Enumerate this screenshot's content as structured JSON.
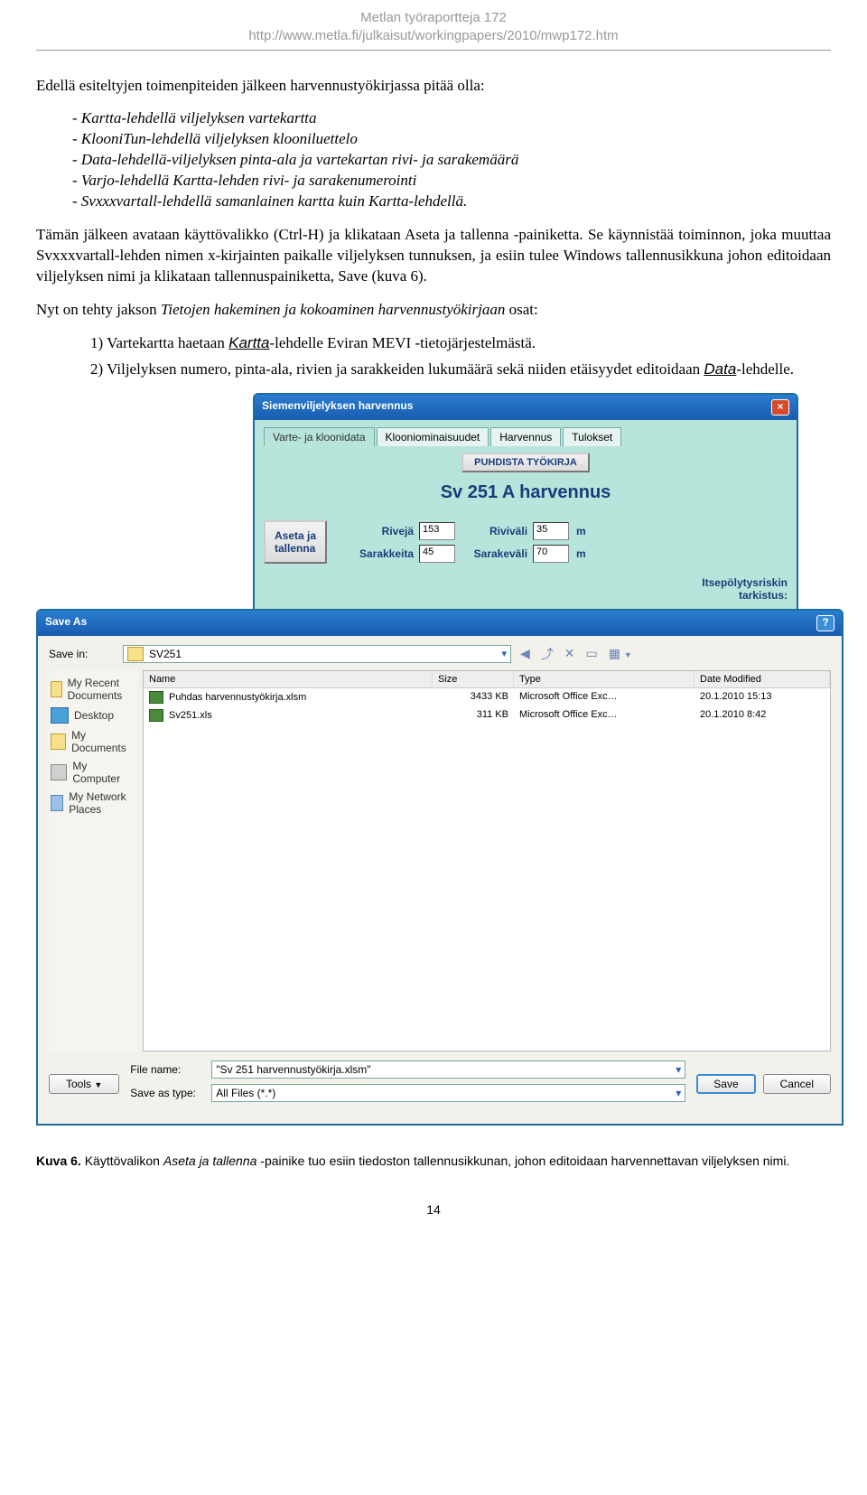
{
  "header": {
    "line1": "Metlan työraportteja 172",
    "line2": "http://www.metla.fi/julkaisut/workingpapers/2010/mwp172.htm"
  },
  "para1_lead": "Edellä esiteltyjen toimenpiteiden jälkeen harvennustyökirjassa pitää olla:",
  "bullets": [
    "Kartta-lehdellä viljelyksen vartekartta",
    "KlooniTun-lehdellä viljelyksen klooniluettelo",
    "Data-lehdellä-viljelyksen pinta-ala ja vartekartan rivi- ja sarakemäärä",
    "Varjo-lehdellä Kartta-lehden rivi- ja sarakenumerointi",
    "Svxxxvartall-lehdellä samanlainen kartta kuin Kartta-lehdellä."
  ],
  "para2": "Tämän jälkeen avataan käyttövalikko (Ctrl-H) ja klikataan Aseta ja tallenna -painiketta. Se käynnistää toiminnon, joka muuttaa Svxxxvartall-lehden nimen x-kirjainten paikalle viljelyksen tunnuksen, ja esiin tulee Windows tallennusikkuna johon editoidaan viljelyksen nimi ja klikataan tallennuspainiketta, Save (kuva 6).",
  "para3_lead": "Nyt on tehty jakson Tietojen hakeminen ja kokoaminen harvennustyökirjaan osat:",
  "nums": [
    {
      "n": "1)",
      "txt_a": "Vartekartta haetaan ",
      "u": "Kartta",
      "txt_b": "-lehdelle Eviran MEVI -tietojärjestelmästä."
    },
    {
      "n": "2)",
      "txt_a": "Viljelyksen numero, pinta-ala, rivien ja sarakkeiden lukumäärä sekä niiden etäisyydet editoidaan ",
      "u": "Data",
      "txt_b": "-lehdelle."
    }
  ],
  "app": {
    "title": "Siemenviljelyksen harvennus",
    "tabs": [
      "Varte- ja kloonidata",
      "Klooniominaisuudet",
      "Harvennus",
      "Tulokset"
    ],
    "puhdista": "PUHDISTA TYÖKIRJA",
    "heading": "Sv 251 A harvennus",
    "aseta": "Aseta ja\ntallenna",
    "rows_lbl": "Rivejä",
    "rows_val": "153",
    "rowgap_lbl": "Riviväli",
    "rowgap_val": "35",
    "cols_lbl": "Sarakkeita",
    "cols_val": "45",
    "colgap_lbl": "Sarakeväli",
    "colgap_val": "70",
    "unit": "m",
    "status": "Itsepölytysriskin\ntarkistus:"
  },
  "saveas": {
    "title": "Save As",
    "savein_lbl": "Save in:",
    "folder": "SV251",
    "places": [
      "My Recent Documents",
      "Desktop",
      "My Documents",
      "My Computer",
      "My Network Places"
    ],
    "cols": [
      "Name",
      "Size",
      "Type",
      "Date Modified"
    ],
    "files": [
      {
        "name": "Puhdas harvennustyökirja.xlsm",
        "size": "3433 KB",
        "type": "Microsoft Office Exc…",
        "date": "20.1.2010 15:13"
      },
      {
        "name": "Sv251.xls",
        "size": "311 KB",
        "type": "Microsoft Office Exc…",
        "date": "20.1.2010 8:42"
      }
    ],
    "filename_lbl": "File name:",
    "filename_val": "\"Sv 251 harvennustyökirja.xlsm\"",
    "savetype_lbl": "Save as type:",
    "savetype_val": "All Files (*.*)",
    "tools": "Tools",
    "save": "Save",
    "cancel": "Cancel"
  },
  "caption_bold": "Kuva 6.",
  "caption_txt": " Käyttövalikon Aseta ja tallenna -painike tuo esiin tiedoston tallennusikkunan, johon editoidaan harvennettavan viljelyksen nimi.",
  "page_num": "14"
}
